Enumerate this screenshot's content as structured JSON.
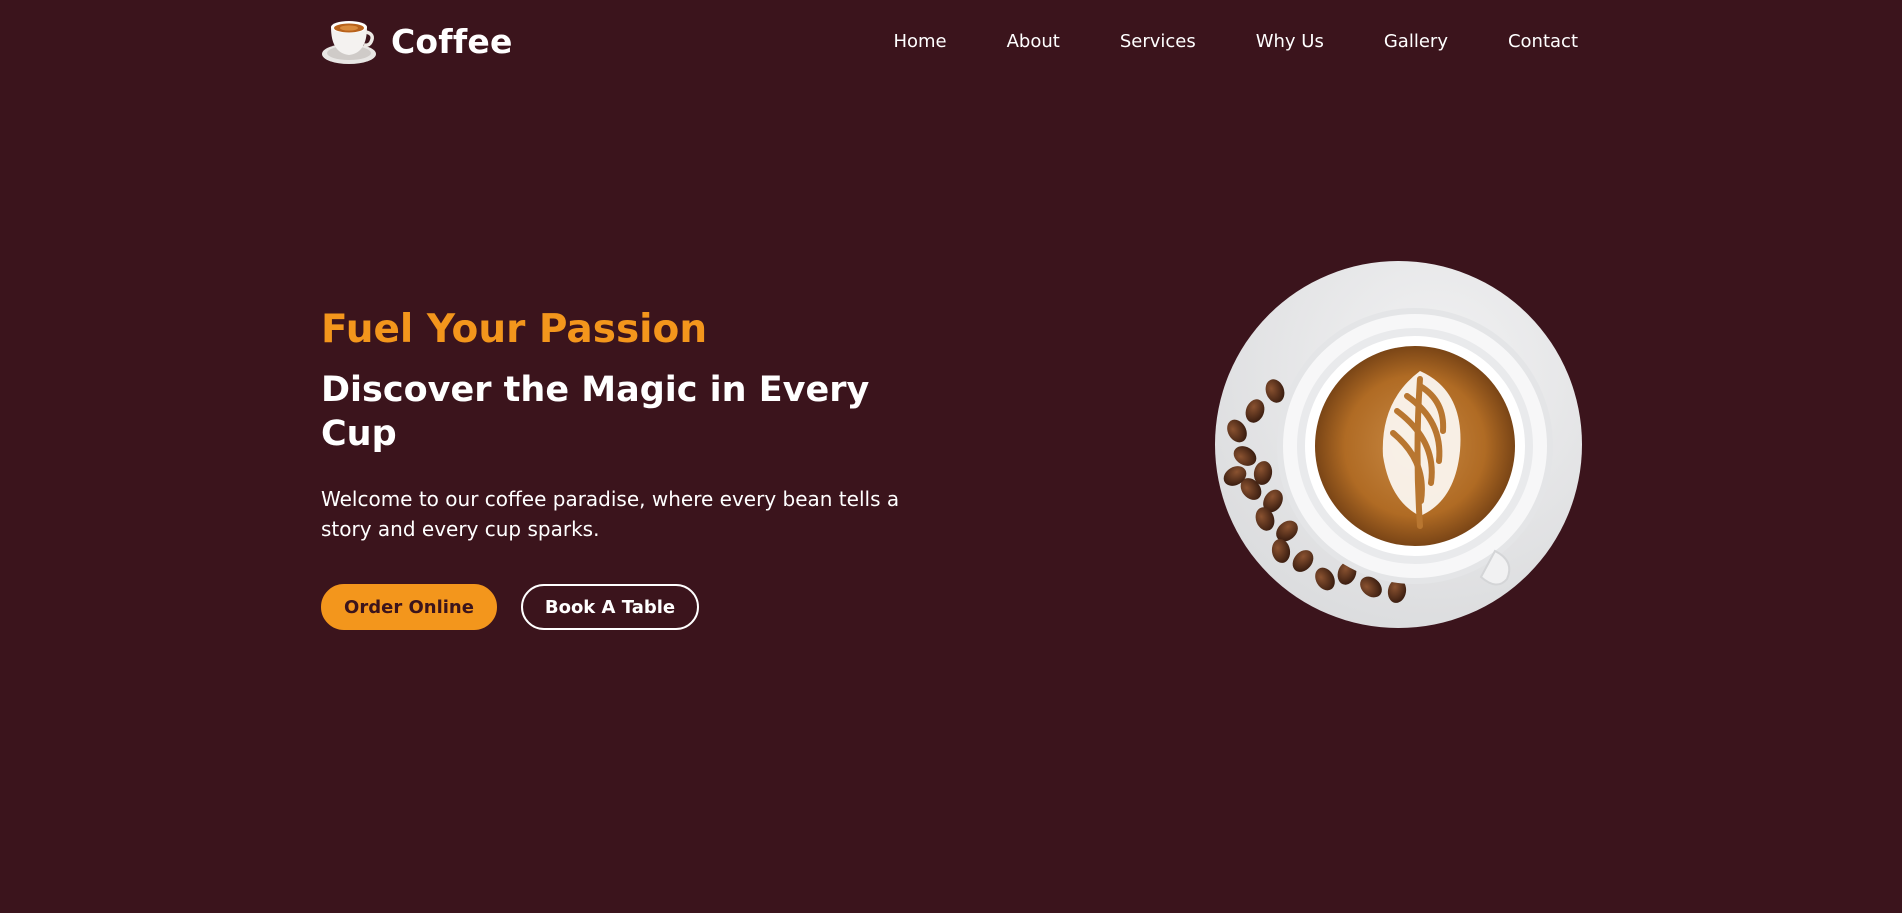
{
  "brand": {
    "name": "Coffee",
    "logo_icon": "coffee-cup-icon"
  },
  "nav": {
    "items": [
      {
        "label": "Home"
      },
      {
        "label": "About"
      },
      {
        "label": "Services"
      },
      {
        "label": "Why Us"
      },
      {
        "label": "Gallery"
      },
      {
        "label": "Contact"
      }
    ]
  },
  "hero": {
    "eyebrow": "Fuel Your Passion",
    "title": "Discover the Magic in Every Cup",
    "description": "Welcome to our coffee paradise, where every bean tells a story and every cup sparks.",
    "buttons": {
      "order_label": "Order Online",
      "book_label": "Book A Table"
    },
    "image_icon": "latte-cup-icon"
  },
  "colors": {
    "background": "#3b141c",
    "accent": "#f3961c",
    "text": "#ffffff"
  }
}
